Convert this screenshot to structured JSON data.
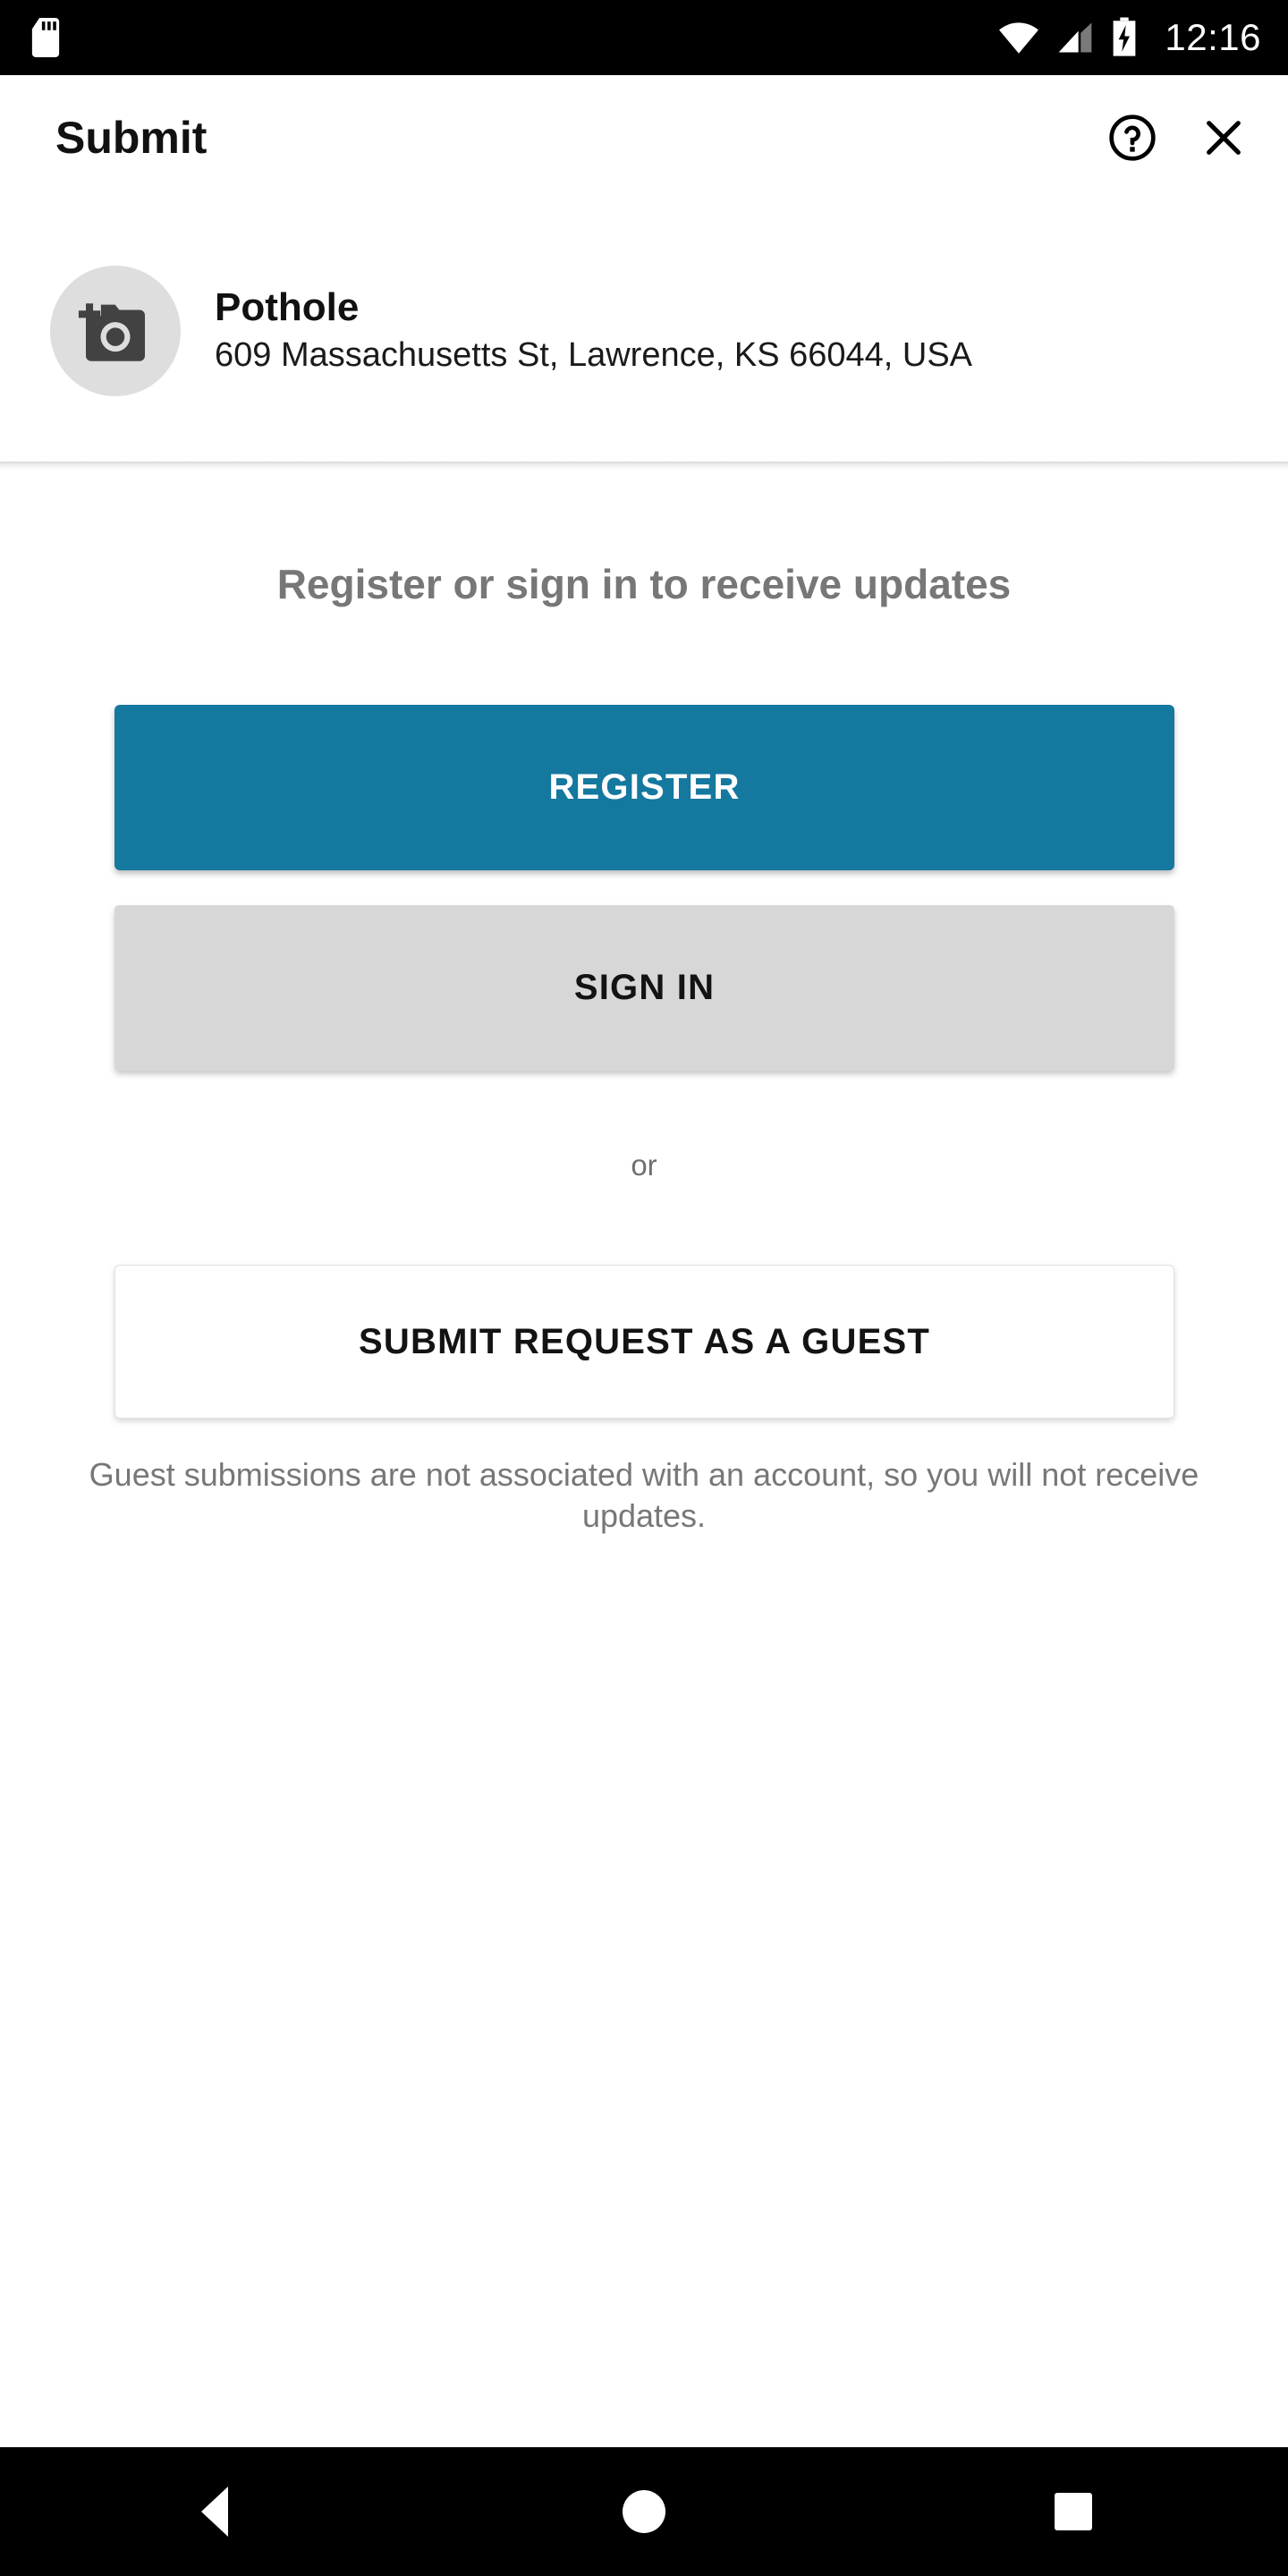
{
  "status_bar": {
    "sd_card_icon": "sd-card-icon",
    "wifi_icon": "wifi-icon",
    "signal_icon": "cell-signal-icon",
    "battery_icon": "battery-charging-icon",
    "time": "12:16",
    "background_color": "#000000"
  },
  "header": {
    "title": "Submit",
    "help_icon": "help-circle-icon",
    "close_icon": "close-icon"
  },
  "item": {
    "avatar_icon": "add-a-photo-icon",
    "title": "Pothole",
    "address": "609 Massachusetts St, Lawrence, KS 66044, USA"
  },
  "main": {
    "heading": "Register or sign in to receive updates",
    "register_label": "REGISTER",
    "signin_label": "SIGN IN",
    "or_label": "or",
    "guest_label": "SUBMIT REQUEST AS A GUEST",
    "guest_note": "Guest submissions are not associated with an account, so you will not receive updates."
  },
  "colors": {
    "primary": "#14789F",
    "secondary": "#D7D7D7",
    "muted_text": "#777777",
    "avatar_bg": "#DEDEDE"
  },
  "nav_bar": {
    "back_icon": "back-triangle-icon",
    "home_icon": "home-circle-icon",
    "recents_icon": "recents-square-icon"
  }
}
